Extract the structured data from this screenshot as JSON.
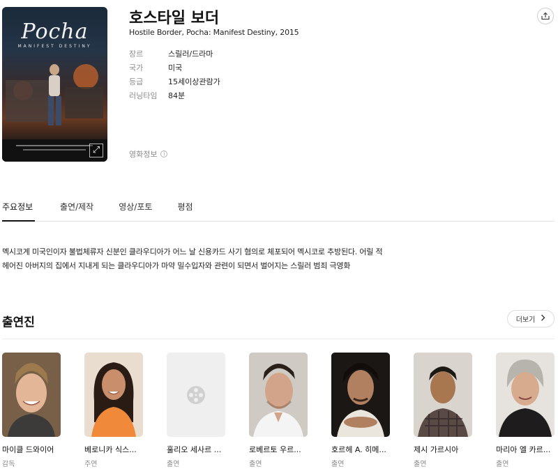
{
  "movie": {
    "title": "호스타일 보더",
    "original": "Hostile Border, Pocha: Manifest Destiny, 2015",
    "poster": {
      "title": "Pocha",
      "subtitle": "MANIFEST DESTINY"
    },
    "meta": [
      {
        "key": "장르",
        "value": "스릴러/드라마"
      },
      {
        "key": "국가",
        "value": "미국"
      },
      {
        "key": "등급",
        "value": "15세이상관람가"
      },
      {
        "key": "러닝타임",
        "value": "84분"
      }
    ],
    "info_link": "영화정보",
    "info_icon": "i"
  },
  "tabs": [
    "주요정보",
    "출연/제작",
    "영상/포토",
    "평점"
  ],
  "synopsis": [
    "멕시코계 미국인이자 불법체류자 신분인 클라우디아가 어느 날 신용카드 사기 혐의로 체포되어 멕시코로 추방된다. 어릴 적",
    "헤어진 아버지의 집에서 지내게 되는 클라우디아가 마약 밀수입자와 관련이 되면서 벌어지는 스릴러 범죄 극영화"
  ],
  "cast": {
    "title": "출연진",
    "more_label": "더보기",
    "people": [
      {
        "name": "마이클 드와이어",
        "role": "감독",
        "photo": "man-smiling"
      },
      {
        "name": "베로니카 식스...",
        "role": "주연",
        "photo": "woman-long-hair"
      },
      {
        "name": "훌리오 세사르 ...",
        "role": "출연",
        "photo": "film-reel-placeholder"
      },
      {
        "name": "로베르토 우르...",
        "role": "출연",
        "photo": "man-white-shirt"
      },
      {
        "name": "호르헤 A. 히메...",
        "role": "출연",
        "photo": "man-tank-top"
      },
      {
        "name": "제시 가르시아",
        "role": "출연",
        "photo": "man-plaid-shirt"
      },
      {
        "name": "마리아 엘 카르...",
        "role": "출연",
        "photo": "woman-gray-hair"
      }
    ]
  },
  "colors": {
    "text": "#222222",
    "muted": "#8a8a8a",
    "border": "#e3e3e3"
  }
}
